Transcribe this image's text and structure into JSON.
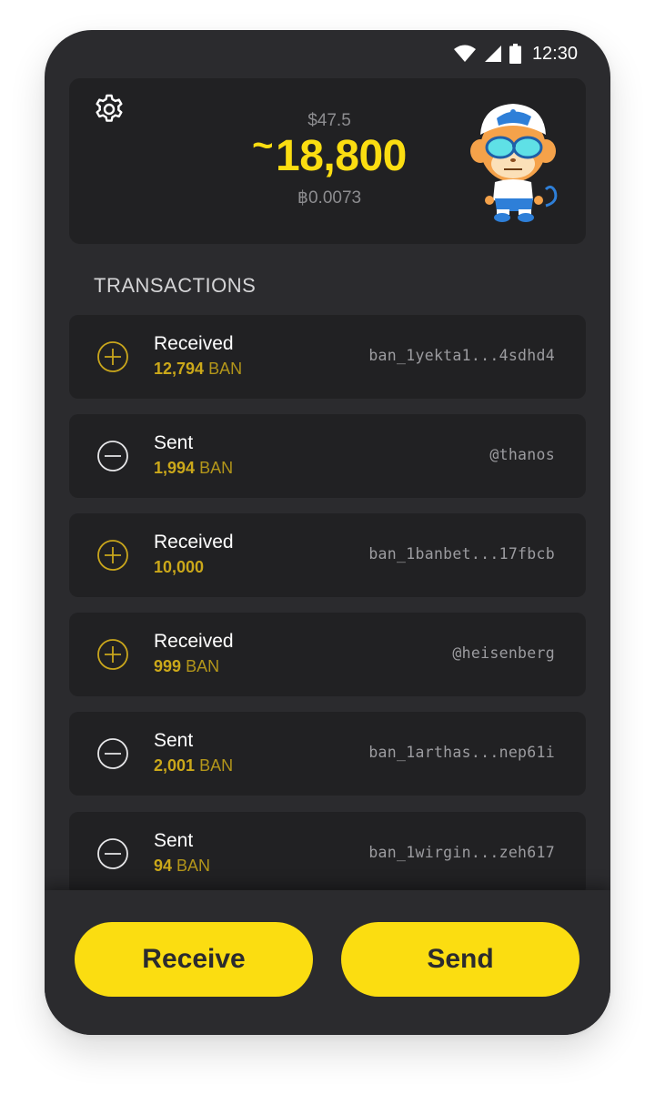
{
  "status_bar": {
    "time": "12:30",
    "icons": [
      "wifi-icon",
      "signal-icon",
      "battery-icon"
    ]
  },
  "header": {
    "settings_icon": "gear-icon",
    "fiat_balance": "$47.5",
    "balance_prefix": "~",
    "balance": "18,800",
    "btc_balance": "฿0.0073",
    "avatar_icon": "monkey-avatar"
  },
  "transactions": {
    "title": "TRANSACTIONS",
    "items": [
      {
        "kind": "received",
        "type": "Received",
        "amount": "12,794",
        "unit": "BAN",
        "address": "ban_1yekta1...4sdhd4",
        "icon": "plus-circle-icon"
      },
      {
        "kind": "sent",
        "type": "Sent",
        "amount": "1,994",
        "unit": "BAN",
        "address": "@thanos",
        "icon": "minus-circle-icon"
      },
      {
        "kind": "received",
        "type": "Received",
        "amount": "10,000",
        "unit": "",
        "address": "ban_1banbet...17fbcb",
        "icon": "plus-circle-icon"
      },
      {
        "kind": "received",
        "type": "Received",
        "amount": "999",
        "unit": "BAN",
        "address": "@heisenberg",
        "icon": "plus-circle-icon"
      },
      {
        "kind": "sent",
        "type": "Sent",
        "amount": "2,001",
        "unit": "BAN",
        "address": "ban_1arthas...nep61i",
        "icon": "minus-circle-icon"
      },
      {
        "kind": "sent",
        "type": "Sent",
        "amount": "94",
        "unit": "BAN",
        "address": "ban_1wirgin...zeh617",
        "icon": "minus-circle-icon"
      }
    ]
  },
  "actions": {
    "receive_label": "Receive",
    "send_label": "Send"
  },
  "colors": {
    "accent": "#fbdd11",
    "background": "#2b2b2e",
    "card": "#212123",
    "received_icon": "#c9a61c",
    "sent_icon": "#e6e6e8"
  }
}
